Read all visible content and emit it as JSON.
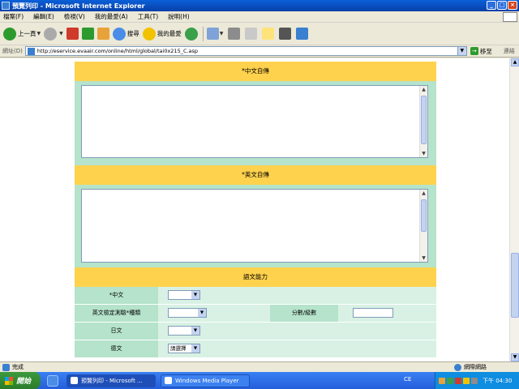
{
  "window": {
    "title": "預覽列印 - Microsoft Internet Explorer",
    "controls": [
      "_",
      "□",
      "×"
    ]
  },
  "menu": {
    "items": [
      "檔案(F)",
      "編輯(E)",
      "檢視(V)",
      "我的最愛(A)",
      "工具(T)",
      "說明(H)"
    ]
  },
  "toolbar": {
    "back_label": "上一頁",
    "search_label": "搜尋",
    "favorites_label": "我的最愛"
  },
  "address": {
    "label": "網址(D)",
    "url": "http://eservice.evaair.com/online/html/global/tai0x215_C.asp",
    "go_label": "移至",
    "links_label": "連結"
  },
  "page": {
    "chinese_bio_heading": "*中文自傳",
    "english_bio_heading": "*英文自傳",
    "language_heading": "語文能力",
    "rows": {
      "chinese_label": "*中文",
      "english_test_label": "英文檢定測驗*種類",
      "score_label": "分數/級數",
      "japanese_label": "日文",
      "german_label": "德文",
      "german_select": "請選擇"
    }
  },
  "statusbar": {
    "status": "完成",
    "zone": "網際網路"
  },
  "taskbar": {
    "start_label": "開始",
    "tasks": [
      "預覽列印 - Microsoft ...",
      "Windows Media Player"
    ],
    "lang": "CE",
    "clock": "下午 04:30"
  },
  "colors": {
    "heading_bg": "#ffd24d",
    "label_bg": "#b5e3cb",
    "value_bg": "#d8f1e4"
  }
}
